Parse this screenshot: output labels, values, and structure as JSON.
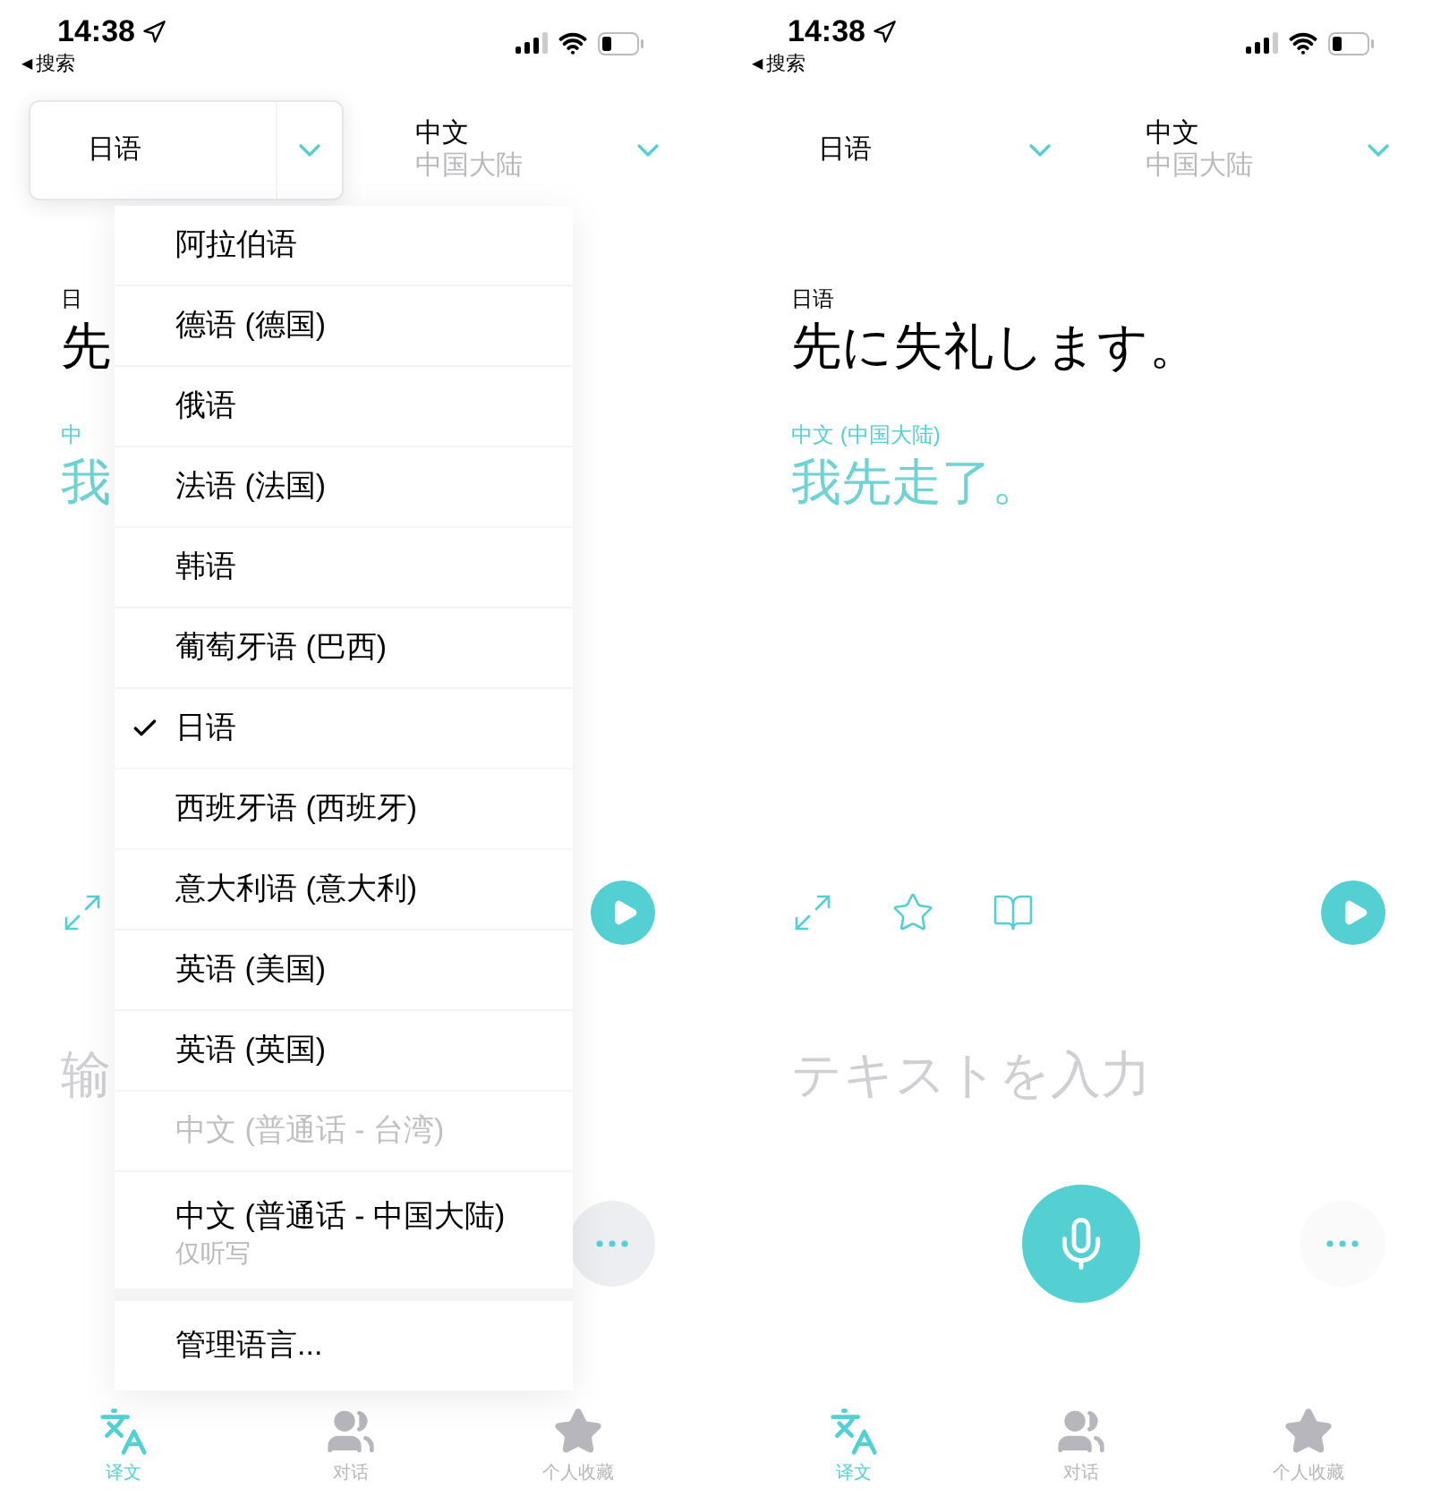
{
  "screens": [
    {
      "status_bar": {
        "time": "14:38",
        "back_arrow": "◀",
        "back_label": "搜索"
      },
      "source_selector": {
        "language": "日语",
        "expanded": true
      },
      "target_selector": {
        "language": "中文",
        "region": "中国大陆"
      },
      "source_label": "日",
      "source_text": "先",
      "target_label": "中",
      "target_text": "我",
      "actions": [
        {
          "kind": "expand"
        }
      ],
      "input": {
        "placeholder": "输"
      },
      "mic": false,
      "language_menu": [
        {
          "kind": "language",
          "label": "阿拉伯语",
          "selected": false,
          "disabled": false
        },
        {
          "kind": "language",
          "label": "德语 (德国)",
          "selected": false,
          "disabled": false
        },
        {
          "kind": "language",
          "label": "俄语",
          "selected": false,
          "disabled": false
        },
        {
          "kind": "language",
          "label": "法语 (法国)",
          "selected": false,
          "disabled": false
        },
        {
          "kind": "language",
          "label": "韩语",
          "selected": false,
          "disabled": false
        },
        {
          "kind": "language",
          "label": "葡萄牙语 (巴西)",
          "selected": false,
          "disabled": false
        },
        {
          "kind": "language",
          "label": "日语",
          "selected": true,
          "disabled": false
        },
        {
          "kind": "language",
          "label": "西班牙语 (西班牙)",
          "selected": false,
          "disabled": false
        },
        {
          "kind": "language",
          "label": "意大利语 (意大利)",
          "selected": false,
          "disabled": false
        },
        {
          "kind": "language",
          "label": "英语 (美国)",
          "selected": false,
          "disabled": false
        },
        {
          "kind": "language",
          "label": "英语 (英国)",
          "selected": false,
          "disabled": false
        },
        {
          "kind": "language",
          "label": "中文 (普通话 - 台湾)",
          "selected": false,
          "disabled": true
        },
        {
          "kind": "language",
          "label": "中文 (普通话 - 中国大陆)",
          "note": "仅听写",
          "selected": false,
          "disabled": false
        },
        {
          "kind": "action",
          "label": "管理语言..."
        }
      ],
      "tabs": [
        {
          "label": "译文",
          "kind": "translate",
          "selected": true
        },
        {
          "label": "对话",
          "kind": "conversation",
          "selected": false
        },
        {
          "label": "个人收藏",
          "kind": "favorites",
          "selected": false
        }
      ]
    },
    {
      "status_bar": {
        "time": "14:38",
        "back_arrow": "◀",
        "back_label": "搜索"
      },
      "source_selector": {
        "language": "日语",
        "expanded": false
      },
      "target_selector": {
        "language": "中文",
        "region": "中国大陆"
      },
      "source_label": "日语",
      "source_text": "先に失礼します。",
      "target_label": "中文 (中国大陆)",
      "target_text": "我先走了。",
      "actions": [
        {
          "kind": "expand"
        },
        {
          "kind": "favorite"
        },
        {
          "kind": "dictionary"
        }
      ],
      "input": {
        "placeholder": "テキストを入力"
      },
      "mic": true,
      "tabs": [
        {
          "label": "译文",
          "kind": "translate",
          "selected": true
        },
        {
          "label": "对话",
          "kind": "conversation",
          "selected": false
        },
        {
          "label": "个人收藏",
          "kind": "favorites",
          "selected": false
        }
      ]
    }
  ]
}
